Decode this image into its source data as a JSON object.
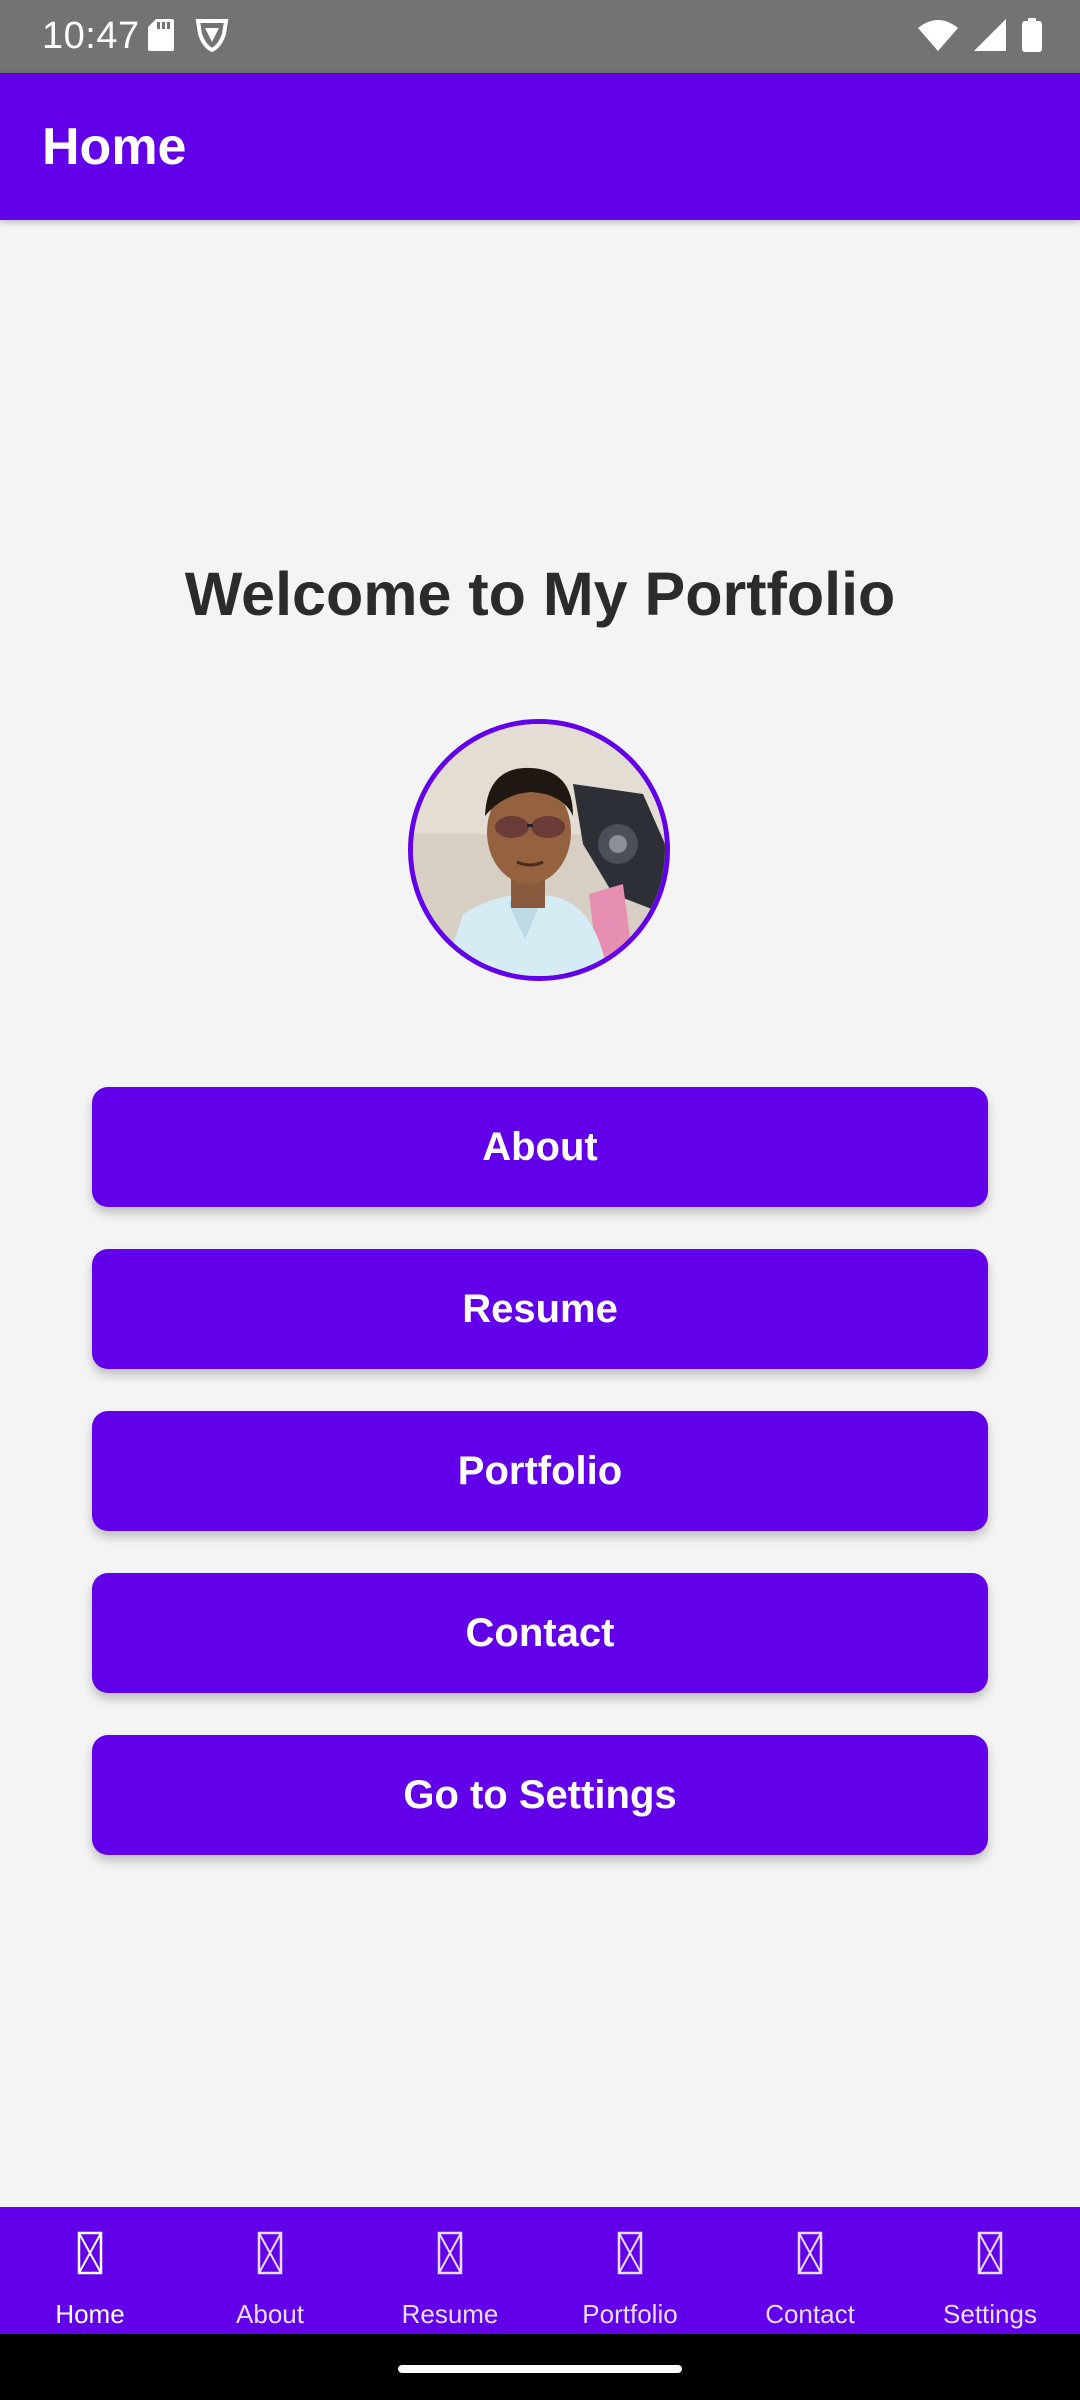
{
  "status_bar": {
    "time": "10:47",
    "left_icons": [
      "sd-card-icon",
      "vpn-shield-icon"
    ],
    "right_icons": [
      "wifi-icon",
      "cellular-signal-icon",
      "battery-icon"
    ]
  },
  "app_bar": {
    "title": "Home"
  },
  "main": {
    "welcome_title": "Welcome to My Portfolio",
    "buttons": {
      "about": "About",
      "resume": "Resume",
      "portfolio": "Portfolio",
      "contact": "Contact",
      "settings": "Go to Settings"
    }
  },
  "bottom_nav": {
    "items": [
      {
        "label": "Home",
        "active": true
      },
      {
        "label": "About",
        "active": false
      },
      {
        "label": "Resume",
        "active": false
      },
      {
        "label": "Portfolio",
        "active": false
      },
      {
        "label": "Contact",
        "active": false
      },
      {
        "label": "Settings",
        "active": false
      }
    ],
    "icon": "missing-glyph-icon"
  },
  "colors": {
    "primary": "#6200ea",
    "background": "#f4f4f4",
    "status_bar": "#737373",
    "title_text": "#2b2b2b"
  }
}
